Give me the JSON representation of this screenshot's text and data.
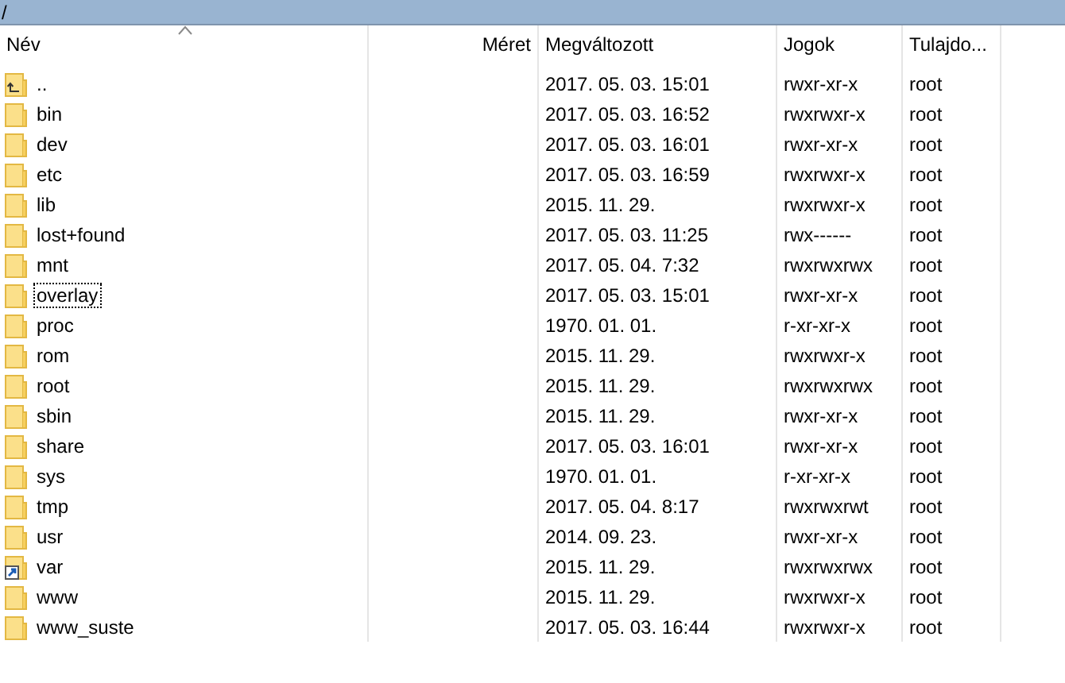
{
  "path_bar": {
    "text": "/"
  },
  "columns": [
    {
      "label": "Név",
      "sorted": true
    },
    {
      "label": "Méret",
      "sorted": false
    },
    {
      "label": "Megváltozott",
      "sorted": false
    },
    {
      "label": "Jogok",
      "sorted": false
    },
    {
      "label": "Tulajdo...",
      "sorted": false
    }
  ],
  "rows": [
    {
      "kind": "parent",
      "name": "..",
      "modified": "2017. 05. 03. 15:01",
      "rights": "rwxr-xr-x",
      "owner": "root",
      "focused": false
    },
    {
      "kind": "folder",
      "name": "bin",
      "modified": "2017. 05. 03. 16:52",
      "rights": "rwxrwxr-x",
      "owner": "root",
      "focused": false
    },
    {
      "kind": "folder",
      "name": "dev",
      "modified": "2017. 05. 03. 16:01",
      "rights": "rwxr-xr-x",
      "owner": "root",
      "focused": false
    },
    {
      "kind": "folder",
      "name": "etc",
      "modified": "2017. 05. 03. 16:59",
      "rights": "rwxrwxr-x",
      "owner": "root",
      "focused": false
    },
    {
      "kind": "folder",
      "name": "lib",
      "modified": "2015. 11. 29.",
      "rights": "rwxrwxr-x",
      "owner": "root",
      "focused": false
    },
    {
      "kind": "folder",
      "name": "lost+found",
      "modified": "2017. 05. 03. 11:25",
      "rights": "rwx------",
      "owner": "root",
      "focused": false
    },
    {
      "kind": "folder",
      "name": "mnt",
      "modified": "2017. 05. 04. 7:32",
      "rights": "rwxrwxrwx",
      "owner": "root",
      "focused": false
    },
    {
      "kind": "folder",
      "name": "overlay",
      "modified": "2017. 05. 03. 15:01",
      "rights": "rwxr-xr-x",
      "owner": "root",
      "focused": true
    },
    {
      "kind": "folder",
      "name": "proc",
      "modified": "1970. 01. 01.",
      "rights": "r-xr-xr-x",
      "owner": "root",
      "focused": false
    },
    {
      "kind": "folder",
      "name": "rom",
      "modified": "2015. 11. 29.",
      "rights": "rwxrwxr-x",
      "owner": "root",
      "focused": false
    },
    {
      "kind": "folder",
      "name": "root",
      "modified": "2015. 11. 29.",
      "rights": "rwxrwxrwx",
      "owner": "root",
      "focused": false
    },
    {
      "kind": "folder",
      "name": "sbin",
      "modified": "2015. 11. 29.",
      "rights": "rwxr-xr-x",
      "owner": "root",
      "focused": false
    },
    {
      "kind": "folder",
      "name": "share",
      "modified": "2017. 05. 03. 16:01",
      "rights": "rwxr-xr-x",
      "owner": "root",
      "focused": false
    },
    {
      "kind": "folder",
      "name": "sys",
      "modified": "1970. 01. 01.",
      "rights": "r-xr-xr-x",
      "owner": "root",
      "focused": false
    },
    {
      "kind": "folder",
      "name": "tmp",
      "modified": "2017. 05. 04. 8:17",
      "rights": "rwxrwxrwt",
      "owner": "root",
      "focused": false
    },
    {
      "kind": "folder",
      "name": "usr",
      "modified": "2014. 09. 23.",
      "rights": "rwxr-xr-x",
      "owner": "root",
      "focused": false
    },
    {
      "kind": "symlink",
      "name": "var",
      "modified": "2015. 11. 29.",
      "rights": "rwxrwxrwx",
      "owner": "root",
      "focused": false
    },
    {
      "kind": "folder",
      "name": "www",
      "modified": "2015. 11. 29.",
      "rights": "rwxrwxr-x",
      "owner": "root",
      "focused": false
    },
    {
      "kind": "folder",
      "name": "www_suste",
      "modified": "2017. 05. 03. 16:44",
      "rights": "rwxrwxr-x",
      "owner": "root",
      "focused": false
    }
  ]
}
